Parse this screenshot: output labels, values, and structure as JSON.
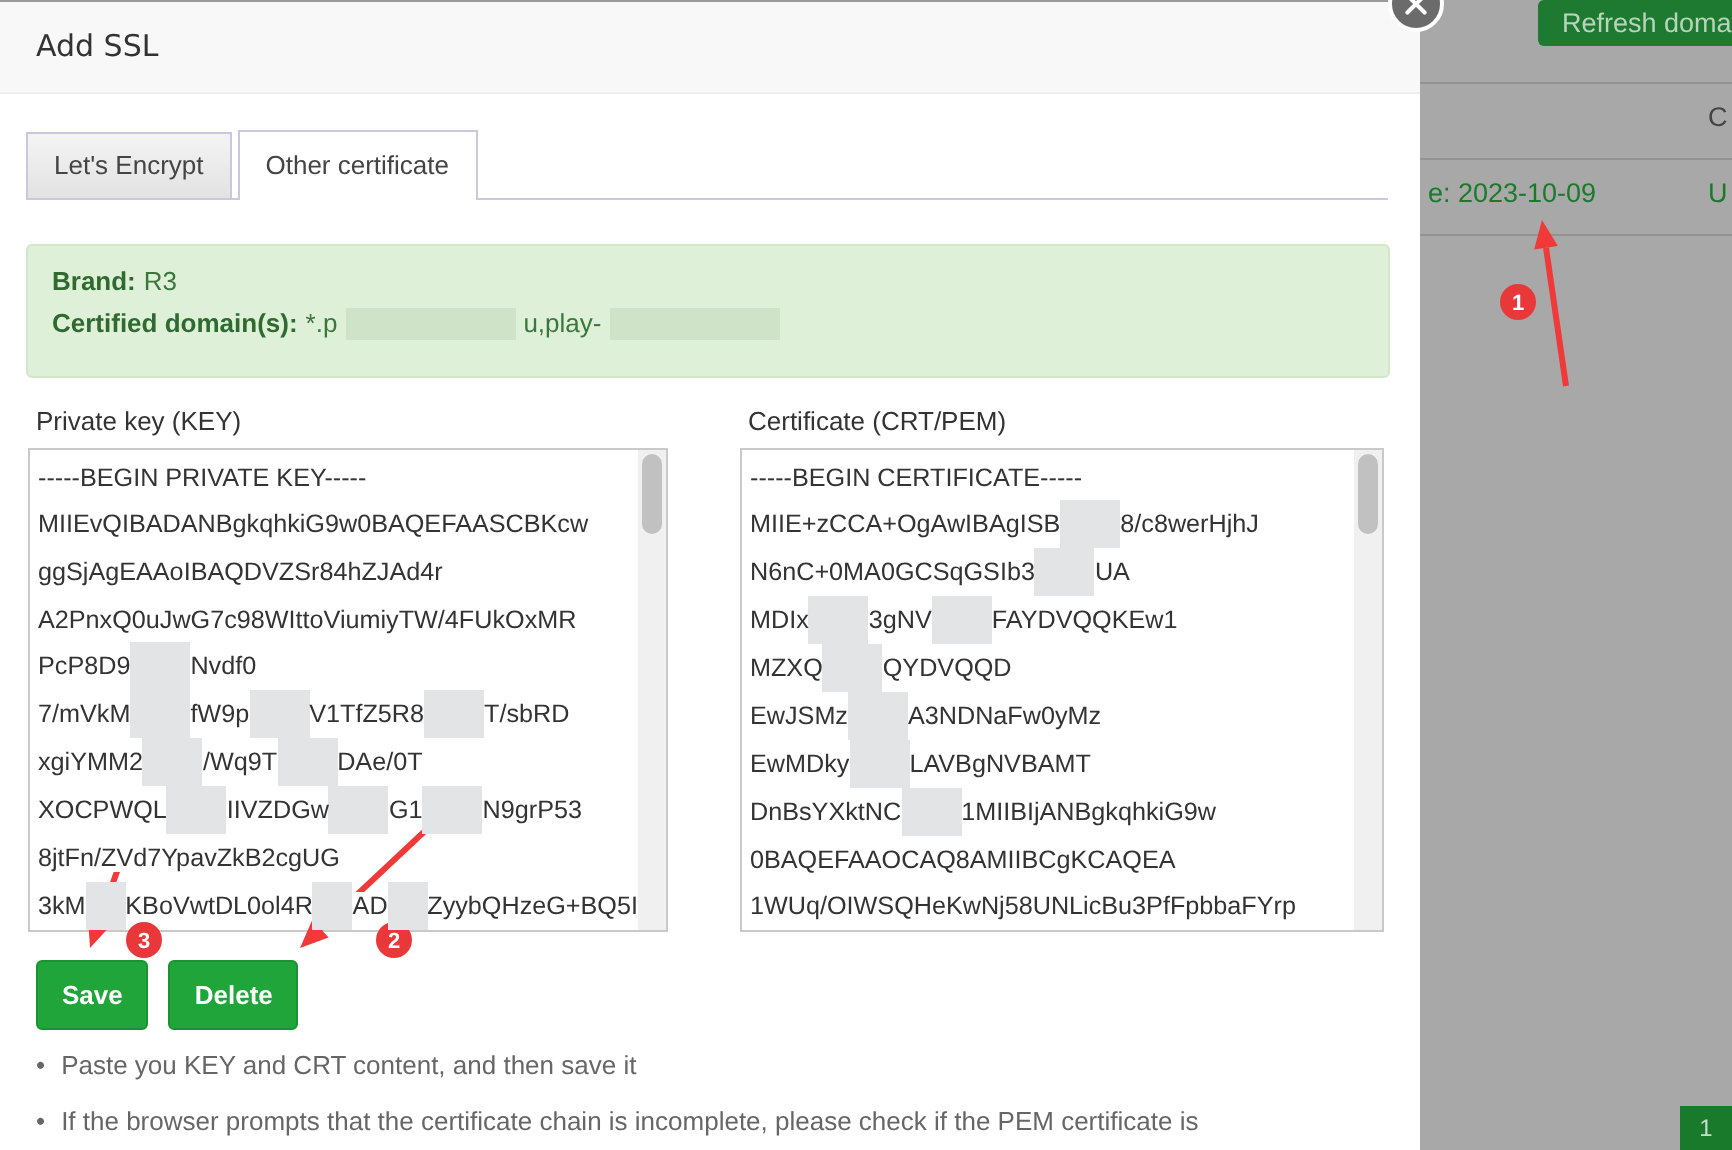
{
  "dialog": {
    "title": "Add SSL"
  },
  "tabs": [
    {
      "label": "Let's Encrypt",
      "selected": false
    },
    {
      "label": "Other certificate",
      "selected": true
    }
  ],
  "info": {
    "brand_label": "Brand:",
    "brand": "R3",
    "domains_label": "Certified domain(s):",
    "domains": [
      "*.p",
      "u,play-"
    ],
    "domains_tail_redacted": true
  },
  "fields": [
    {
      "label": "Private key (KEY)",
      "lines": [
        [
          "-----BEGIN PRIVATE KEY-----"
        ],
        [
          "MIIEvQIBADANBgkqhkiG9w0BAQEFAASCBKcw"
        ],
        [
          "ggSjAgEAAoIBAQDVZSr84hZJAd4r"
        ],
        [
          "A2PnxQ0uJwG7c98WIttoViumiyTW/4FUkOxMR"
        ],
        [
          "PcP8D9",
          "Nvdf0"
        ],
        [
          "7/mVkM",
          "fW9p",
          "V1TfZ5R8",
          "T/sbRD"
        ],
        [
          "xgiYMM2",
          "/Wq9T",
          "DAe/0T"
        ],
        [
          "XOCPWQL",
          "IIVZDGw",
          "G1",
          "N9grP53"
        ],
        [
          "8jtFn/ZVd7YpavZkB2cgUG"
        ],
        [
          "3kM",
          "KBoVwtDL0ol4R",
          "AD",
          "ZyybQHzeG+BQ5I"
        ]
      ]
    },
    {
      "label": "Certificate (CRT/PEM)",
      "lines": [
        [
          "-----BEGIN CERTIFICATE-----"
        ],
        [
          "MIIE+zCCA+OgAwIBAgISB",
          "8/c8werHjhJ"
        ],
        [
          "N6nC+0MA0GCSqGSIb3",
          "UA"
        ],
        [
          "MDIx",
          "3gNV",
          "FAYDVQQKEw1"
        ],
        [
          "MZXQ",
          "QYDVQQD"
        ],
        [
          "EwJSMz",
          "A3NDNaFw0yMz"
        ],
        [
          "EwMDky",
          "LAVBgNVBAMT"
        ],
        [
          "DnBsYXktNC",
          "1MIIBIjANBgkqhkiG9w"
        ],
        [
          "0BAQEFAAOCAQ8AMIIBCgKCAQEA"
        ],
        [
          "1WUq/OIWSQHeKwNj58UNLicBu3PfFpbbaFYrp"
        ]
      ]
    }
  ],
  "buttons": [
    {
      "label": "Save"
    },
    {
      "label": "Delete"
    }
  ],
  "notes": [
    {
      "bullet": "•",
      "text": "Paste you KEY and CRT content, and then save it"
    },
    {
      "bullet": "•",
      "text": "If the browser prompts that the certificate chain is incomplete, please check if the PEM certificate is"
    }
  ],
  "background": {
    "button": "Refresh doma",
    "column_header": "C",
    "expiry": "e: 2023-10-09",
    "cell": "U",
    "page": "1"
  },
  "annotations": [
    {
      "number": "1"
    },
    {
      "number": "2"
    },
    {
      "number": "3"
    }
  ]
}
